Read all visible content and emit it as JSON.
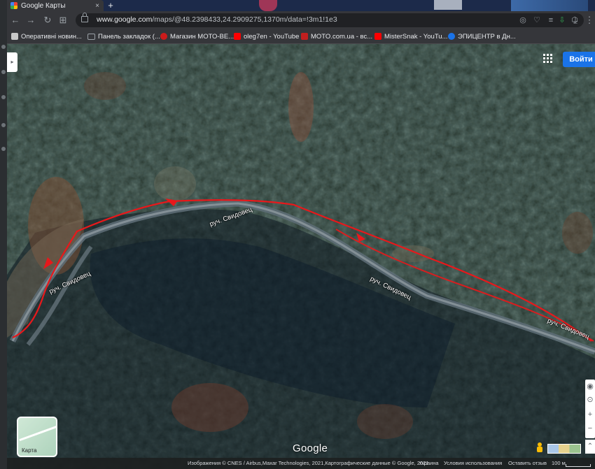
{
  "browser": {
    "tab_title": "Google Карты",
    "tab_close": "×",
    "new_tab": "+",
    "url_host": "www.google.com",
    "url_path": "/maps/@48.2398433,24.2909275,1370m/data=!3m1!1e3"
  },
  "bookmarks": [
    {
      "label": "Оперативні новин...",
      "icon": "news-favicon",
      "color": "#c8c8c8"
    },
    {
      "label": "Панель закладок (...",
      "icon": "folder-icon",
      "color": "#9aa0a6"
    },
    {
      "label": "Магазин МОТО-ВЕ...",
      "icon": "moto-shop-favicon",
      "color": "#cc1b1b"
    },
    {
      "label": "oleg7en - YouTube",
      "icon": "youtube-favicon",
      "color": "#ff0000"
    },
    {
      "label": "MOTO.com.ua - вс...",
      "icon": "moto-favicon",
      "color": "#c21f1f"
    },
    {
      "label": "MisterSnak - YouTu...",
      "icon": "youtube-favicon",
      "color": "#ff0000"
    },
    {
      "label": "ЭПИЦЕНТР в Дн...",
      "icon": "epicentr-favicon",
      "color": "#1a73e8"
    }
  ],
  "map": {
    "signin_label": "Войти",
    "layer_label": "Карта",
    "logo": "Google",
    "river_labels": [
      "руч. Свидовец",
      "руч. Свидовец",
      "руч. Свидовец",
      "руч. Свидовец"
    ],
    "track_color": "#e8181b",
    "attribution": {
      "imagery": "Изображения © CNES / Airbus,Maxar Technologies, 2021,Картографические данные © Google, 2021",
      "country": "Украина",
      "terms": "Условия использования",
      "feedback": "Оставить отзыв",
      "scale": "100 м"
    }
  }
}
